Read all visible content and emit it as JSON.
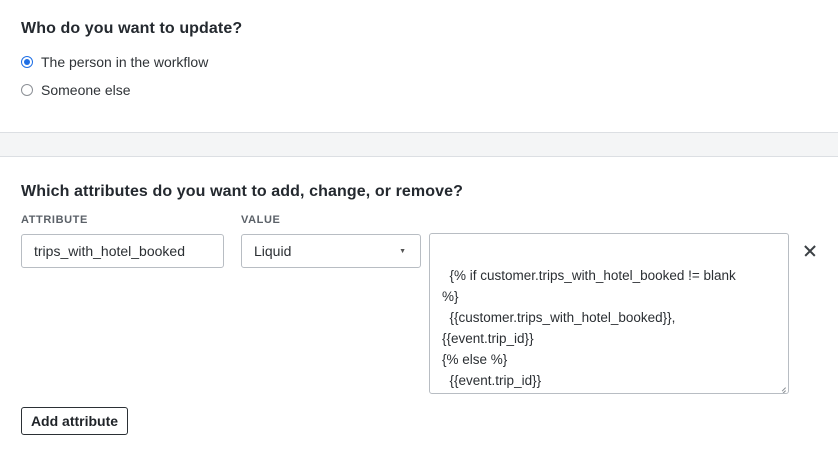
{
  "who_section": {
    "heading": "Who do you want to update?",
    "options": [
      {
        "label": "The person in the workflow",
        "selected": true
      },
      {
        "label": "Someone else",
        "selected": false
      }
    ]
  },
  "attributes_section": {
    "heading": "Which attributes do you want to add, change, or remove?",
    "attribute_column_label": "ATTRIBUTE",
    "value_column_label": "VALUE",
    "row": {
      "attribute_value": "trips_with_hotel_booked",
      "value_type": "Liquid",
      "liquid_code": "{% if customer.trips_with_hotel_booked != blank\n%}\n  {{customer.trips_with_hotel_booked}},\n{{event.trip_id}}\n{% else %}\n  {{event.trip_id}}\n{% endif %}"
    },
    "add_button_label": "Add attribute"
  },
  "colors": {
    "radio_accent": "#1f6fe5",
    "divider_band": "#f4f5f6"
  },
  "icons": {
    "remove": "close-icon",
    "select_caret": "chevron-down-icon"
  }
}
